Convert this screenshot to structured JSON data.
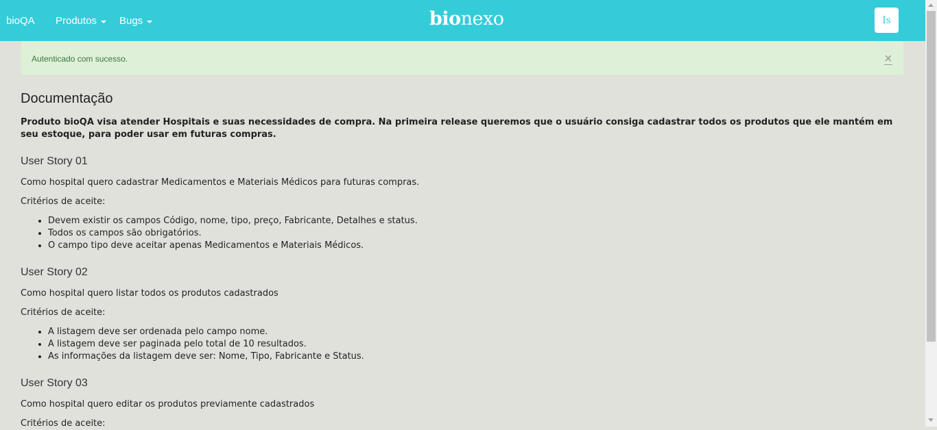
{
  "navbar": {
    "brand": "bioQA",
    "menus": [
      {
        "label": "Produtos"
      },
      {
        "label": "Bugs"
      }
    ],
    "logo": {
      "bold": "bio",
      "light": "nexo"
    },
    "user_initials": "Is",
    "color": "#35ccd9"
  },
  "alert": {
    "message": "Autenticado com sucesso.",
    "close": "×"
  },
  "doc": {
    "title": "Documentação",
    "intro": "Produto bioQA visa atender Hospitais e suas necessidades de compra. Na primeira release queremos que o usuário consiga cadastrar todos os produtos que ele mantém em seu estoque, para poder usar em futuras compras.",
    "stories": [
      {
        "title": "User Story 01",
        "description": "Como hospital quero cadastrar Medicamentos e Materiais Médicos para futuras compras.",
        "criteria_label": "Critérios de aceite:",
        "criteria": [
          "Devem existir os campos Código, nome, tipo, preço, Fabricante, Detalhes e status.",
          "Todos os campos são obrigatórios.",
          "O campo tipo deve aceitar apenas Medicamentos e Materiais Médicos."
        ]
      },
      {
        "title": "User Story 02",
        "description": "Como hospital quero listar todos os produtos cadastrados",
        "criteria_label": "Critérios de aceite:",
        "criteria": [
          "A listagem deve ser ordenada pelo campo nome.",
          "A listagem deve ser paginada pelo total de 10 resultados.",
          "As informações da listagem deve ser: Nome, Tipo, Fabricante e Status."
        ]
      },
      {
        "title": "User Story 03",
        "description": "Como hospital quero editar os produtos previamente cadastrados",
        "criteria_label": "Critérios de aceite:"
      }
    ]
  }
}
